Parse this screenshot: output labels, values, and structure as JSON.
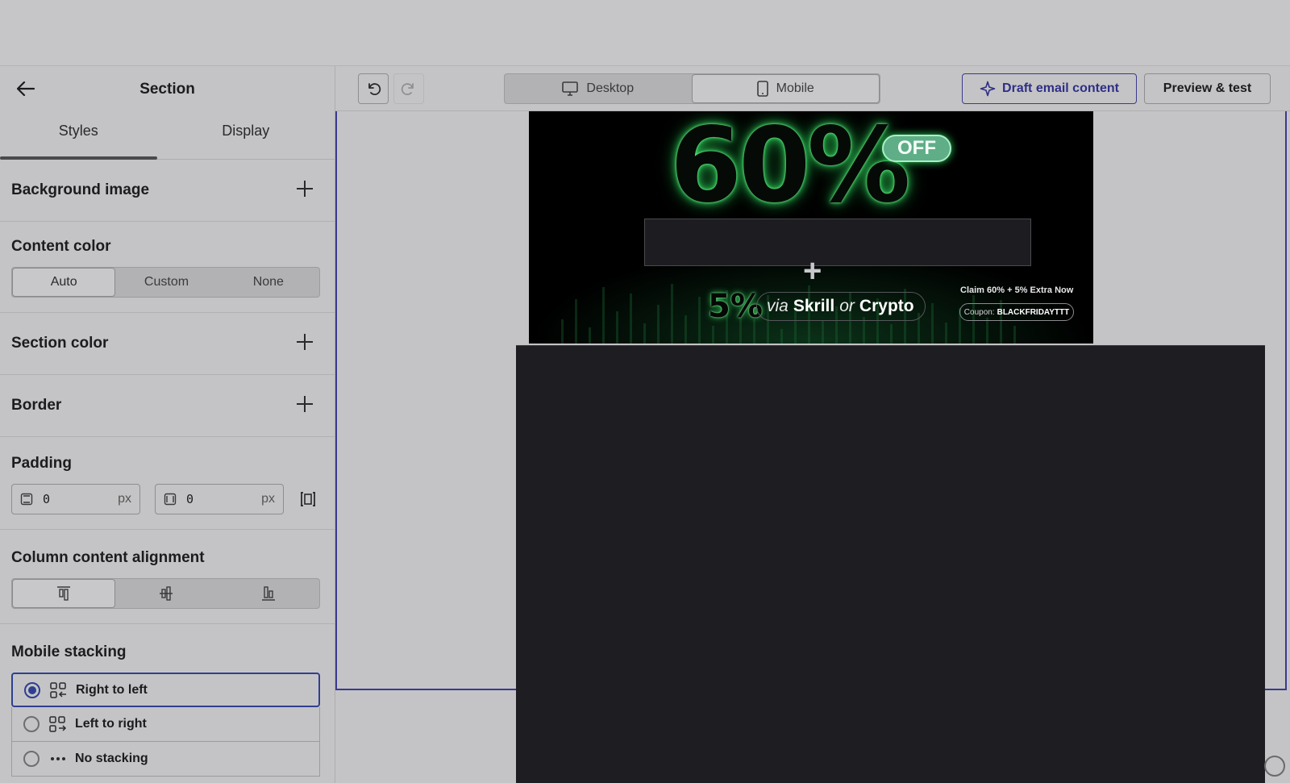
{
  "sidebar": {
    "title": "Section",
    "tabs": [
      {
        "label": "Styles",
        "active": true
      },
      {
        "label": "Display",
        "active": false
      }
    ],
    "background_image": {
      "label": "Background image"
    },
    "content_color": {
      "label": "Content color",
      "options": [
        {
          "label": "Auto",
          "active": true
        },
        {
          "label": "Custom",
          "active": false
        },
        {
          "label": "None",
          "active": false
        }
      ]
    },
    "section_color": {
      "label": "Section color"
    },
    "border": {
      "label": "Border"
    },
    "padding": {
      "label": "Padding",
      "vertical": {
        "value": "0",
        "unit": "px"
      },
      "horizontal": {
        "value": "0",
        "unit": "px"
      }
    },
    "column_alignment": {
      "label": "Column content alignment"
    },
    "mobile_stacking": {
      "label": "Mobile stacking",
      "options": [
        {
          "label": "Right to left",
          "selected": true
        },
        {
          "label": "Left to right",
          "selected": false
        },
        {
          "label": "No stacking",
          "selected": false
        }
      ]
    }
  },
  "toolbar": {
    "views": [
      {
        "label": "Desktop",
        "active": false
      },
      {
        "label": "Mobile",
        "active": true
      }
    ],
    "draft_label": "Draft email content",
    "preview_label": "Preview & test"
  },
  "banner": {
    "headline": "60%",
    "off": "OFF",
    "plus": "+",
    "extra": "5%",
    "via": "via",
    "skrill": "Skrill",
    "or": "or",
    "crypto": "Crypto",
    "claim": "Claim 60% + 5% Extra Now",
    "coupon_label": "Coupon:",
    "coupon_code": "BLACKFRIDAYTTT"
  },
  "colors": {
    "accent": "#2f3f8f",
    "glow": "#2ed35a",
    "dark_block": "#1d1d22"
  }
}
